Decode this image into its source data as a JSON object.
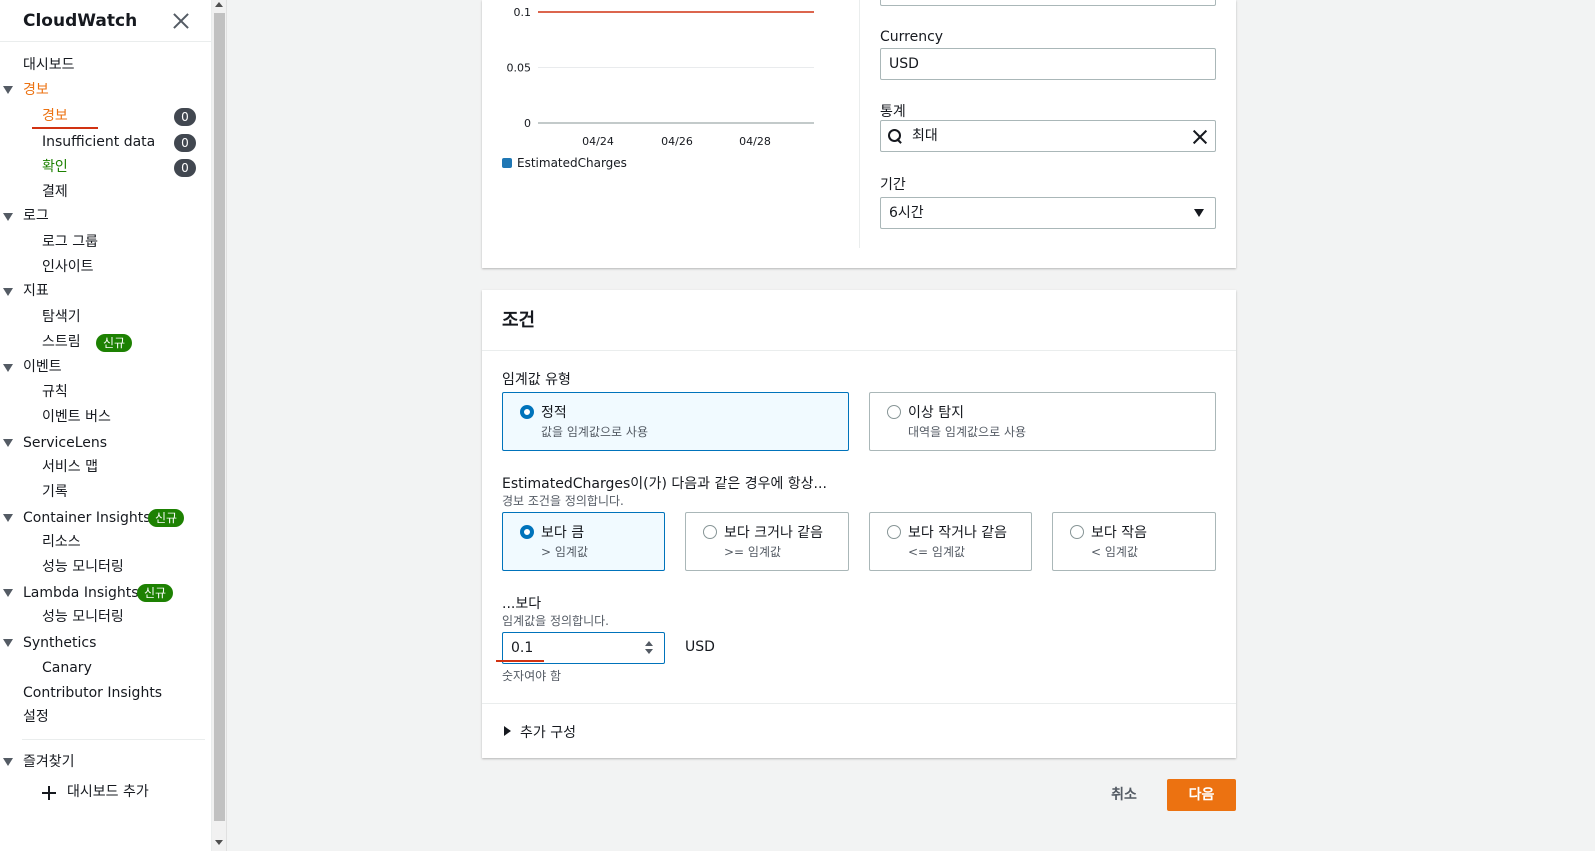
{
  "sidebar": {
    "title": "CloudWatch",
    "items": [
      {
        "label": "대시보드"
      },
      {
        "label": "경보"
      },
      {
        "label": "경보",
        "count": "0"
      },
      {
        "label": "Insufficient data",
        "count": "0"
      },
      {
        "label": "확인",
        "count": "0"
      },
      {
        "label": "결제"
      },
      {
        "label": "로그"
      },
      {
        "label": "로그 그룹"
      },
      {
        "label": "인사이트"
      },
      {
        "label": "지표"
      },
      {
        "label": "탐색기"
      },
      {
        "label": "스트림",
        "badge": "신규"
      },
      {
        "label": "이벤트"
      },
      {
        "label": "규칙"
      },
      {
        "label": "이벤트 버스"
      },
      {
        "label": "ServiceLens"
      },
      {
        "label": "서비스 맵"
      },
      {
        "label": "기록"
      },
      {
        "label": "Container Insights",
        "badge": "신규"
      },
      {
        "label": "리소스"
      },
      {
        "label": "성능 모니터링"
      },
      {
        "label": "Lambda Insights",
        "badge": "신규"
      },
      {
        "label": "성능 모니터링"
      },
      {
        "label": "Synthetics"
      },
      {
        "label": "Canary"
      },
      {
        "label": "Contributor Insights"
      },
      {
        "label": "설정"
      }
    ],
    "favorites": {
      "label": "즐겨찾기",
      "add_label": "대시보드 추가"
    }
  },
  "metric_form": {
    "currency_label": "Currency",
    "currency_value": "USD",
    "statistic_label": "통계",
    "statistic_value": "최대",
    "period_label": "기간",
    "period_value": "6시간"
  },
  "chart_data": {
    "type": "line",
    "x": [
      "04/24",
      "04/26",
      "04/28"
    ],
    "series": [
      {
        "name": "EstimatedCharges",
        "values": [
          0.1,
          0.1,
          0.1
        ]
      }
    ],
    "yticks": [
      "0.1",
      "0.05",
      "0"
    ],
    "ylim": [
      0,
      0.1
    ],
    "grid": true,
    "legend": "bottom-left",
    "colors": {
      "series": "#d13212",
      "legend_swatch": "#1f77b4"
    }
  },
  "conditions": {
    "title": "조건",
    "threshold_type_label": "임계값 유형",
    "threshold_types": [
      {
        "label": "정적",
        "desc": "값을 임계값으로 사용",
        "selected": true
      },
      {
        "label": "이상 탐지",
        "desc": "대역을 임계값으로 사용",
        "selected": false
      }
    ],
    "whenever_label": "EstimatedCharges이(가) 다음과 같은 경우에 항상...",
    "whenever_desc": "경보 조건을 정의합니다.",
    "operators": [
      {
        "label": "보다 큼",
        "desc": "> 임계값",
        "selected": true
      },
      {
        "label": "보다 크거나 같음",
        "desc": ">= 임계값",
        "selected": false
      },
      {
        "label": "보다 작거나 같음",
        "desc": "<= 임계값",
        "selected": false
      },
      {
        "label": "보다 작음",
        "desc": "< 임계값",
        "selected": false
      }
    ],
    "than_label": "...보다",
    "than_desc": "임계값을 정의합니다.",
    "threshold_value": "0.1",
    "unit": "USD",
    "hint": "숫자여야 함",
    "additional_config": "추가 구성"
  },
  "actions": {
    "cancel": "취소",
    "next": "다음"
  },
  "colors": {
    "accent": "#ec7211",
    "selected": "#0073bb",
    "badge_green": "#1d8102"
  }
}
